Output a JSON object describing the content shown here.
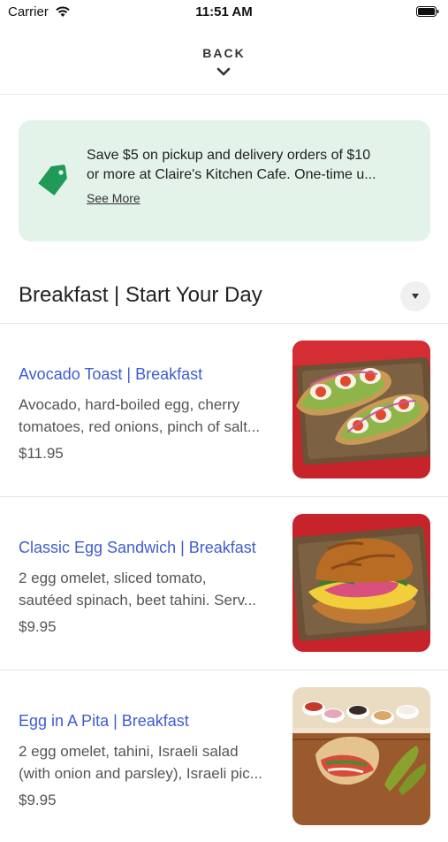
{
  "status_bar": {
    "carrier": "Carrier",
    "time": "11:51 AM",
    "icons": [
      "wifi-icon",
      "battery-icon"
    ]
  },
  "header": {
    "back_label": "BACK",
    "back_icon": "chevron-down-icon"
  },
  "promo": {
    "icon": "tag-icon",
    "line1": "Save $5 on pickup and delivery orders of $10",
    "line2": "or more at Claire's Kitchen Cafe. One-time u...",
    "see_more": "See More",
    "background_color": "#e3f3ea",
    "icon_color": "#1f9a57"
  },
  "section": {
    "title": "Breakfast | Start Your Day",
    "toggle_icon": "caret-down-icon"
  },
  "menu_items": [
    {
      "name": "Avocado Toast | Breakfast",
      "desc_line1": "Avocado, hard-boiled egg, cherry",
      "desc_line2": "tomatoes, red onions, pinch of salt...",
      "price": "$11.95",
      "image": "avocado-toast-photo"
    },
    {
      "name": "Classic Egg Sandwich | Breakfast",
      "desc_line1": "2 egg omelet, sliced tomato,",
      "desc_line2": "sautéed spinach, beet tahini. Serv...",
      "price": "$9.95",
      "image": "egg-sandwich-photo"
    },
    {
      "name": "Egg in A Pita | Breakfast",
      "desc_line1": "2 egg omelet, tahini, Israeli salad",
      "desc_line2": "(with onion and parsley), Israeli pic...",
      "price": "$9.95",
      "image": "egg-pita-photo"
    }
  ],
  "colors": {
    "item_name": "#3f5ccf",
    "text_secondary": "#555555",
    "divider": "#e6e6e6"
  }
}
